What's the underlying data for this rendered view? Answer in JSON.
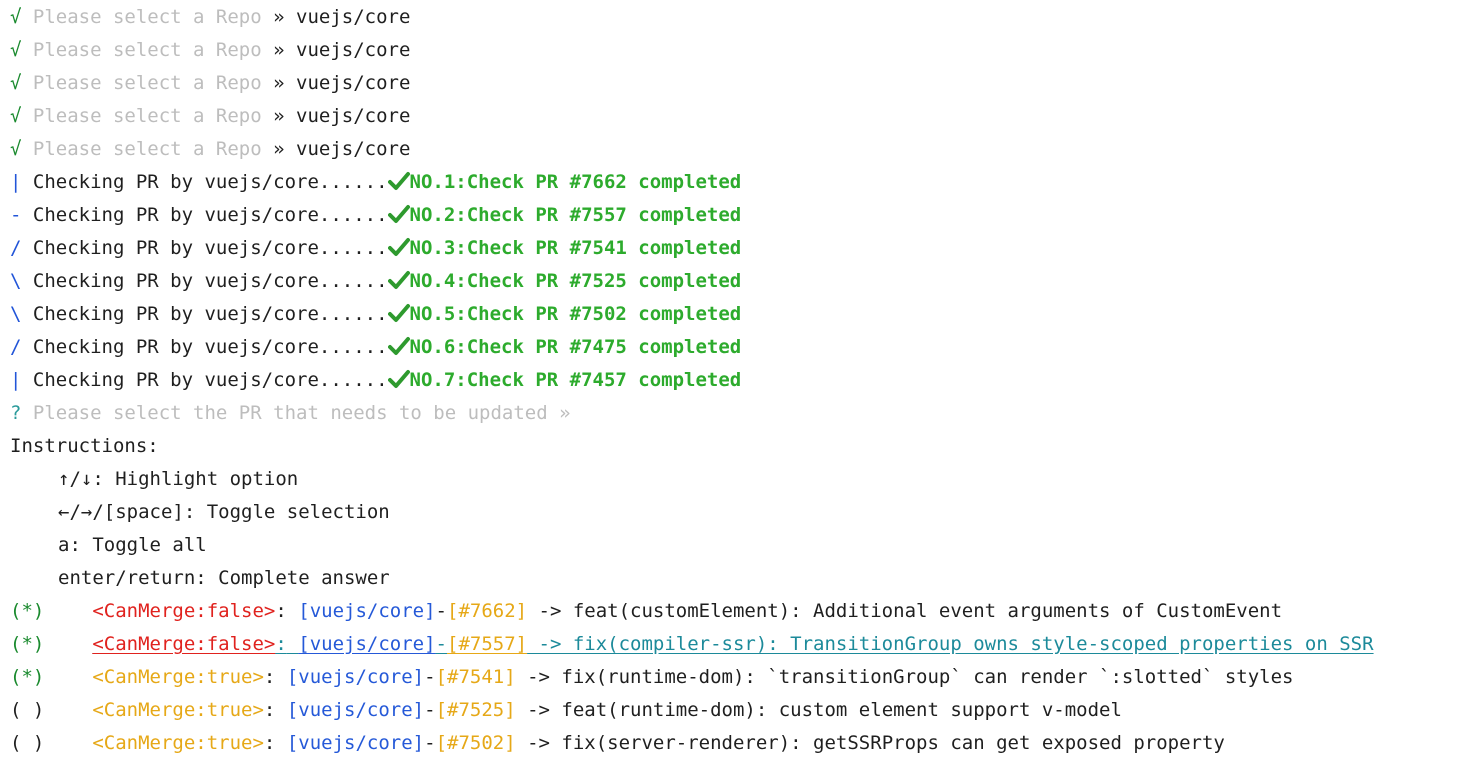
{
  "repo_prompts": [
    {
      "mark": "√",
      "prompt": "Please select a Repo",
      "sep": "»",
      "answer": "vuejs/core"
    },
    {
      "mark": "√",
      "prompt": "Please select a Repo",
      "sep": "»",
      "answer": "vuejs/core"
    },
    {
      "mark": "√",
      "prompt": "Please select a Repo",
      "sep": "»",
      "answer": "vuejs/core"
    },
    {
      "mark": "√",
      "prompt": "Please select a Repo",
      "sep": "»",
      "answer": "vuejs/core"
    },
    {
      "mark": "√",
      "prompt": "Please select a Repo",
      "sep": "»",
      "answer": "vuejs/core"
    }
  ],
  "checks": [
    {
      "spinner": "|",
      "text": "Checking PR by vuejs/core......",
      "result": "NO.1:Check PR #7662 completed"
    },
    {
      "spinner": "-",
      "text": "Checking PR by vuejs/core......",
      "result": "NO.2:Check PR #7557 completed"
    },
    {
      "spinner": "/",
      "text": "Checking PR by vuejs/core......",
      "result": "NO.3:Check PR #7541 completed"
    },
    {
      "spinner": "\\",
      "text": "Checking PR by vuejs/core......",
      "result": "NO.4:Check PR #7525 completed"
    },
    {
      "spinner": "\\",
      "text": "Checking PR by vuejs/core......",
      "result": "NO.5:Check PR #7502 completed"
    },
    {
      "spinner": "/",
      "text": "Checking PR by vuejs/core......",
      "result": "NO.6:Check PR #7475 completed"
    },
    {
      "spinner": "|",
      "text": "Checking PR by vuejs/core......",
      "result": "NO.7:Check PR #7457 completed"
    }
  ],
  "select_prompt": {
    "mark": "?",
    "text": "Please select the PR that needs to be updated",
    "sep": "»"
  },
  "instructions": {
    "title": "Instructions:",
    "items": [
      "↑/↓: Highlight option",
      "←/→/[space]: Toggle selection",
      "a: Toggle all",
      "enter/return: Complete answer"
    ]
  },
  "options": [
    {
      "checkbox": "(*)",
      "can_merge": "<CanMerge:false>",
      "repo": "[vuejs/core]",
      "dash": "-",
      "pr": "[#7662]",
      "desc": " -> feat(customElement): Additional event arguments of CustomEvent",
      "selected": true,
      "merge": false,
      "highlighted": false
    },
    {
      "checkbox": "(*)",
      "can_merge": "<CanMerge:false>",
      "repo": "[vuejs/core]",
      "dash": "-",
      "pr": "[#7557]",
      "desc": " -> fix(compiler-ssr): TransitionGroup owns style-scoped properties on SSR",
      "selected": true,
      "merge": false,
      "highlighted": true
    },
    {
      "checkbox": "(*)",
      "can_merge": "<CanMerge:true>",
      "repo": "[vuejs/core]",
      "dash": "-",
      "pr": "[#7541]",
      "desc": " -> fix(runtime-dom): `transitionGroup` can render `:slotted` styles",
      "selected": true,
      "merge": true,
      "highlighted": false
    },
    {
      "checkbox": "( )",
      "can_merge": "<CanMerge:true>",
      "repo": "[vuejs/core]",
      "dash": "-",
      "pr": "[#7525]",
      "desc": " -> feat(runtime-dom): custom element support v-model",
      "selected": false,
      "merge": true,
      "highlighted": false
    },
    {
      "checkbox": "( )",
      "can_merge": "<CanMerge:true>",
      "repo": "[vuejs/core]",
      "dash": "-",
      "pr": "[#7502]",
      "desc": " -> fix(server-renderer): getSSRProps can get exposed property",
      "selected": false,
      "merge": true,
      "highlighted": false
    }
  ],
  "colon": ":",
  "colors": {
    "ok": "#1a8a2e",
    "done": "#2dab2d",
    "repo": "#2559d8",
    "false": "#e0221e",
    "true": "#e6a817",
    "highlight": "#1c8a9a"
  }
}
